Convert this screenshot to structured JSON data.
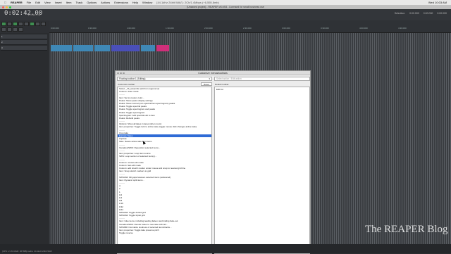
{
  "menubar": {
    "app_name": "REAPER",
    "items": [
      "File",
      "Edit",
      "View",
      "Insert",
      "Item",
      "Track",
      "Options",
      "Actions",
      "Extensions",
      "Help",
      "Window"
    ],
    "info": "[44.1kHz 24bit WAV] : 2Ch/1.4Mbps (~6,555.8mb)",
    "right": [
      "Wed 10:03 AM"
    ]
  },
  "window": {
    "title": "[Unsaved project] - REAPER v6.x/64 - Licensed for small business use"
  },
  "transport": {
    "time": "0:02:42.00",
    "state": "[Stopped]",
    "right_info": [
      "Selection:",
      "0:00.000",
      "0:00.000",
      "0:00.000"
    ]
  },
  "ruler": {
    "marks": [
      "0:00.000",
      "0:30.000",
      "1:00.000",
      "1:30.000",
      "2:00.000",
      "2:30.000",
      "3:00.000",
      "3:30.000",
      "4:00.000",
      "4:30.000"
    ]
  },
  "tracks": [
    "1",
    "2",
    "3"
  ],
  "colors": {
    "clip_blue": "#3f88b6",
    "clip_purple": "#4a4fb8",
    "clip_pink": "#cf2f7a",
    "selection": "#2f6bd6"
  },
  "dialog": {
    "title": "Customize menus/toolbars",
    "menu_select": "Floating toolbar 1 (Editing)",
    "left_label": "Customize toolbar",
    "reset_label": "Reset",
    "right_select": "Select action / Edit action",
    "right_label": "Default toolbar",
    "right_items": [
      "Edit list"
    ],
    "list": [
      {
        "t": "Script: _JS_assemble edit from regions.lua",
        "s": ""
      },
      {
        "t": "Custom: video mode",
        "s": ""
      },
      {
        "t": "--------",
        "s": "sep"
      },
      {
        "t": "Item: Set to custom color...",
        "s": ""
      },
      {
        "t": "Peaks: Show peaks display settings",
        "s": ""
      },
      {
        "t": "Peaks: Show normal (non-spectral/non-spectrogram) peaks",
        "s": ""
      },
      {
        "t": "Peaks: Toggle spectral peaks",
        "s": ""
      },
      {
        "t": "Peaks: Toggle spectrogram and peaks",
        "s": ""
      },
      {
        "t": "Peaks: Toggle spectrogram",
        "s": ""
      },
      {
        "t": "Spectrogram: Add spectral edit to item",
        "s": ""
      },
      {
        "t": "Peaks: Rebuild peaks",
        "s": ""
      },
      {
        "t": "--------",
        "s": "sep"
      },
      {
        "t": "Options: Show all takes in lanes (when room)",
        "s": ""
      },
      {
        "t": "Item properties: Toggle lock to active take (toggle mouse click changes active take)",
        "s": ""
      },
      {
        "t": "--------",
        "s": "sep"
      },
      {
        "t": "Crop take",
        "s": ""
      },
      {
        "t": "Explode Takes",
        "s": "sel"
      },
      {
        "t": "Implode",
        "s": ""
      },
      {
        "t": "Take: Delete active take from items",
        "s": ""
      },
      {
        "t": "--------",
        "s": "sep"
      },
      {
        "t": "Xenakios/SWS: Reposition selected items...",
        "s": ""
      },
      {
        "t": "--------",
        "s": "sep"
      },
      {
        "t": "Item properties: Loop item source",
        "s": ""
      },
      {
        "t": "SWS: Loop section of selected item(s)...",
        "s": ""
      },
      {
        "t": "--------",
        "s": "sep"
      },
      {
        "t": "Custom: nonsel edit mode",
        "s": ""
      },
      {
        "t": "Custom: fast edit mode",
        "s": ""
      },
      {
        "t": "Custom: add stretch marker under mouse and snap to nearest grid line",
        "s": ""
      },
      {
        "t": "Item: Snap stretch markers to grid",
        "s": ""
      },
      {
        "t": "--------",
        "s": "sep"
      },
      {
        "t": "SWS/AW: Fill gaps between selected items (advanced)",
        "s": ""
      },
      {
        "t": "Item: Dynamic split items...",
        "s": ""
      },
      {
        "t": "--------",
        "s": "sep"
      },
      {
        "t": "4",
        "s": ""
      },
      {
        "t": "2",
        "s": ""
      },
      {
        "t": "1",
        "s": ""
      },
      {
        "t": "1/2",
        "s": ""
      },
      {
        "t": "1/4",
        "s": ""
      },
      {
        "t": "1/8",
        "s": ""
      },
      {
        "t": "1/16",
        "s": ""
      },
      {
        "t": "1/32",
        "s": ""
      },
      {
        "t": "1/64",
        "s": ""
      },
      {
        "t": "SWS/AW: Toggle dotted grid",
        "s": ""
      },
      {
        "t": "SWS/AW: Toggle triplet grid",
        "s": ""
      },
      {
        "t": "--------",
        "s": "sep"
      },
      {
        "t": "Item: Glue items, including leading fade-in and trailing fade-out",
        "s": ""
      },
      {
        "t": "Xenakios/SWS: Render takes to new take with tail...",
        "s": ""
      },
      {
        "t": "SWS/BR: Normalize loudness of selected items/tracks...",
        "s": ""
      },
      {
        "t": "Item properties: Toggle take preserve pitch",
        "s": ""
      },
      {
        "t": "Toggle reverse",
        "s": ""
      }
    ]
  },
  "statusbar": "[CPU: 2.1% RAM: 367MB] Audio: 44.1kHz 24bit WAV",
  "watermark": "The REAPER Blog"
}
